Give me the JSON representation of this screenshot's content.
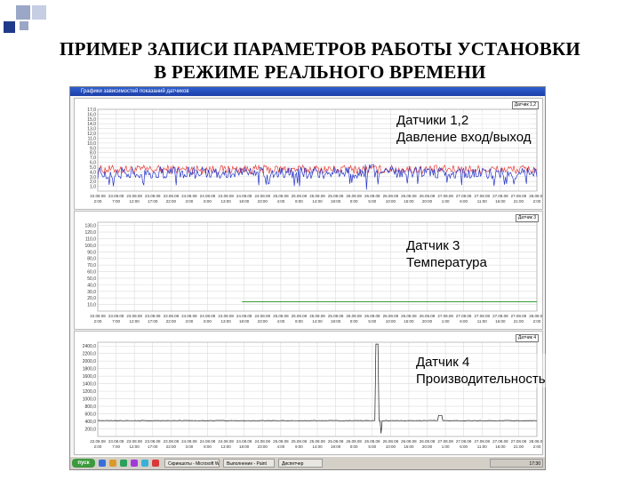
{
  "slide": {
    "title_line1": "ПРИМЕР ЗАПИСИ ПАРАМЕТРОВ РАБОТЫ УСТАНОВКИ",
    "title_line2": "В РЕЖИМЕ РЕАЛЬНОГО ВРЕМЕНИ"
  },
  "window": {
    "title": "Графики зависимостей показаний датчиков"
  },
  "labels": {
    "sensor12_line1": "Датчики 1,2",
    "sensor12_line2": "Давление вход/выход",
    "sensor3_line1": "Датчик 3",
    "sensor3_line2": "Температура",
    "sensor4_line1": "Датчик 4",
    "sensor4_line2": "Производительность"
  },
  "taskbar": {
    "start_label": "пуск",
    "task1": "Скриншоты - Microsoft Word",
    "task2": "Выполнение - Paint",
    "task3": "Диспетчер",
    "clock": "17:30"
  },
  "colors": {
    "series_red": "#e8423c",
    "series_blue": "#2432c8",
    "series_green": "#1c8c1c",
    "series_black": "#202020",
    "grid": "#dcdcdc"
  },
  "chart_data": [
    {
      "type": "line",
      "selector": "Датчик 1,2",
      "y_ticks": [
        "17,0",
        "16,0",
        "15,0",
        "14,0",
        "13,0",
        "12,0",
        "11,0",
        "10,0",
        "9,0",
        "8,0",
        "7,0",
        "6,0",
        "5,0",
        "4,0",
        "3,0",
        "2,0",
        "1,0"
      ],
      "ylim": [
        0,
        17
      ],
      "x_ticks": [
        "22.08.08 2:00",
        "23.08.08 7:00",
        "23.08.08 12:00",
        "23.08.08 17:00",
        "23.08.08 22:00",
        "24.08.08 3:00",
        "24.08.08 8:00",
        "24.08.08 13:00",
        "24.08.08 18:00",
        "24.08.08 23:00",
        "25.08.08 4:00",
        "25.08.08 9:00",
        "25.08.08 14:00",
        "25.08.08 19:00",
        "26.08.08 0:00",
        "26.08.08 5:00",
        "26.08.08 10:00",
        "26.08.08 15:00",
        "26.08.08 20:00",
        "27.08.08 1:00",
        "27.08.08 6:00",
        "27.08.08 11:00",
        "27.08.08 16:00",
        "27.08.08 21:00",
        "28.08.08 2:00"
      ],
      "series": [
        {
          "color_key": "series_red",
          "baseline": 4.5,
          "noise": 0.9
        },
        {
          "color_key": "series_blue",
          "baseline": 3.8,
          "noise": 1.2,
          "dips_to": 1.0,
          "spikes_near_x": 0.62,
          "spike_to": 5.5
        }
      ]
    },
    {
      "type": "line",
      "selector": "Датчик 3",
      "y_ticks": [
        "130,0",
        "120,0",
        "110,0",
        "100,0",
        "90,0",
        "80,0",
        "70,0",
        "60,0",
        "50,0",
        "40,0",
        "30,0",
        "20,0",
        "10,0"
      ],
      "ylim": [
        0,
        135
      ],
      "x_ticks": [
        "22.08.08 2:00",
        "23.08.08 7:00",
        "23.08.08 12:00",
        "23.08.08 17:00",
        "23.08.08 22:00",
        "24.08.08 3:00",
        "24.08.08 8:00",
        "24.08.08 13:00",
        "24.08.08 18:00",
        "24.08.08 23:00",
        "25.08.08 4:00",
        "25.08.08 9:00",
        "25.08.08 14:00",
        "25.08.08 19:00",
        "26.08.08 0:00",
        "26.08.08 5:00",
        "26.08.08 10:00",
        "26.08.08 15:00",
        "26.08.08 20:00",
        "27.08.08 1:00",
        "27.08.08 6:00",
        "27.08.08 11:00",
        "27.08.08 16:00",
        "27.08.08 21:00",
        "28.08.08 2:00"
      ],
      "series": [
        {
          "color_key": "series_green",
          "constant": 14
        }
      ]
    },
    {
      "type": "line",
      "selector": "Датчик 4",
      "y_ticks": [
        "2400,0",
        "2200,0",
        "2000,0",
        "1800,0",
        "1600,0",
        "1400,0",
        "1200,0",
        "1000,0",
        "800,0",
        "600,0",
        "400,0",
        "200,0"
      ],
      "ylim": [
        0,
        2500
      ],
      "x_ticks": [
        "22.08.08 2:00",
        "23.08.08 7:00",
        "23.08.08 12:00",
        "23.08.08 17:00",
        "23.08.08 22:00",
        "24.08.08 3:00",
        "24.08.08 8:00",
        "24.08.08 13:00",
        "24.08.08 18:00",
        "24.08.08 23:00",
        "25.08.08 4:00",
        "25.08.08 9:00",
        "25.08.08 14:00",
        "25.08.08 19:00",
        "26.08.08 0:00",
        "26.08.08 5:00",
        "26.08.08 10:00",
        "26.08.08 15:00",
        "26.08.08 20:00",
        "27.08.08 1:00",
        "27.08.08 6:00",
        "27.08.08 11:00",
        "27.08.08 16:00",
        "27.08.08 21:00",
        "28.08.08 2:00"
      ],
      "series": [
        {
          "color_key": "series_black",
          "baseline": 420,
          "spike_at_x": 0.64,
          "spike_to": 2450,
          "bump_at_x": 0.78,
          "bump_to": 560
        }
      ]
    }
  ]
}
